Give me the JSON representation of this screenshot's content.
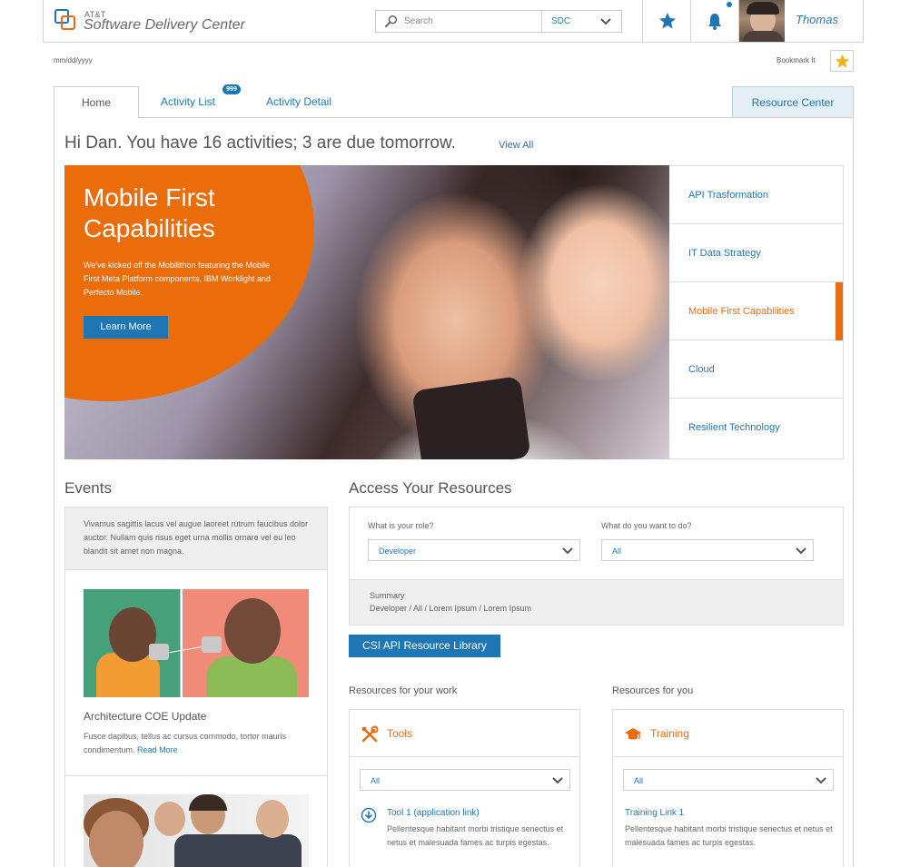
{
  "header": {
    "brand_small": "AT&T",
    "brand": "Software Delivery Center",
    "search_placeholder": "Search",
    "search_scope": "SDC",
    "user_name": "Thomas"
  },
  "subheader": {
    "date": "mm/dd/yyyy",
    "bookmark_label": "Bookmark It"
  },
  "tabs": [
    {
      "label": "Home"
    },
    {
      "label": "Activity List",
      "badge": "999"
    },
    {
      "label": "Activity Detail"
    },
    {
      "label": "Resource Center"
    }
  ],
  "greeting": {
    "text": "Hi Dan. You have 16 activities; 3 are due tomorrow.",
    "link": "View All"
  },
  "hero": {
    "title": "Mobile First Capabilities",
    "text": "We've kicked off the Mobilithon featuring the Mobile First Meta Platform components, IBM Worklight and Perfecto Mobile.",
    "button": "Learn More",
    "nav": [
      "API Trasformation",
      "IT Data Strategy",
      "Mobile First Capabilities",
      "Cloud",
      "Resilient Technology"
    ],
    "active_index": 2,
    "accent": "#e86c12"
  },
  "events": {
    "title": "Events",
    "intro": "Vivamus sagittis lacus vel augue laoreet rutrum faucibus dolor auctor. Nullam quis risus eget urna mollis ornare vel eu leo blandit sit amet non magna.",
    "items": [
      {
        "title": "Architecture COE Update",
        "desc": "Fusce dapibus, tellus ac cursus commodo, tortor mauris condimentum.",
        "link": "Read More"
      }
    ]
  },
  "access": {
    "title": "Access Your Resources",
    "role_label": "What is your role?",
    "role_value": "Developer",
    "do_label": "What do you want to do?",
    "do_value": "All",
    "summary_label": "Summary",
    "summary_value": "Developer / All / Lorem Ipsum / Lorem Ipsum",
    "library_button": "CSI API Resource Library"
  },
  "resources": {
    "work": {
      "label": "Resources for your work",
      "heading": "Tools",
      "filter": "All",
      "link": "Tool 1 (application link)",
      "desc": "Pellentesque habitant morbi tristique senectus et netus et malesuada fames ac turpis egestas."
    },
    "you": {
      "label": "Resources for you",
      "heading": "Training",
      "filter": "All",
      "link": "Training Link 1",
      "desc": "Pellentesque habitant morbi tristique senectus et netus et malesuada fames ac turpis egestas."
    }
  },
  "colors": {
    "accent_orange": "#e86c12",
    "link_blue": "#1f76b4"
  }
}
